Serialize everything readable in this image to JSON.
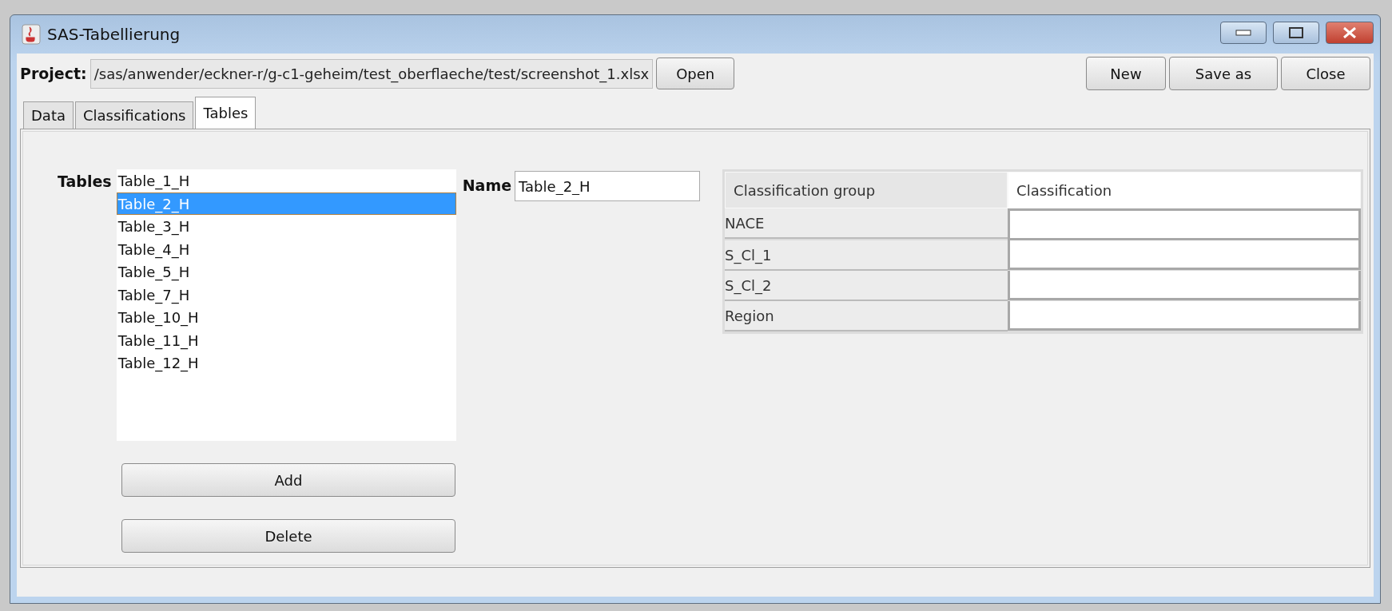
{
  "window": {
    "title": "SAS-Tabellierung"
  },
  "project": {
    "label": "Project:",
    "path": "/sas/anwender/eckner-r/g-c1-geheim/test_oberflaeche/test/screenshot_1.xlsx",
    "open_button": "Open"
  },
  "actions": [
    "New",
    "Save as",
    "Close"
  ],
  "tabs": [
    {
      "label": "Data",
      "selected": false
    },
    {
      "label": "Classifications",
      "selected": false
    },
    {
      "label": "Tables",
      "selected": true
    }
  ],
  "tables_list": {
    "label": "Tables",
    "items": [
      {
        "label": "Table_1_H",
        "selected": false
      },
      {
        "label": "Table_2_H",
        "selected": true
      },
      {
        "label": "Table_3_H",
        "selected": false
      },
      {
        "label": "Table_4_H",
        "selected": false
      },
      {
        "label": "Table_5_H",
        "selected": false
      },
      {
        "label": "Table_7_H",
        "selected": false
      },
      {
        "label": "Table_10_H",
        "selected": false
      },
      {
        "label": "Table_11_H",
        "selected": false
      },
      {
        "label": "Table_12_H",
        "selected": false
      }
    ]
  },
  "name_field": {
    "label": "Name",
    "value": "Table_2_H"
  },
  "list_buttons": [
    "Add",
    "Delete"
  ],
  "table": {
    "columns": [
      "Classification group",
      "Classification"
    ],
    "rows": [
      {
        "group": "NACE"
      },
      {
        "group": "S_Cl_1"
      },
      {
        "group": "S_Cl_2"
      },
      {
        "group": "Region"
      }
    ]
  }
}
